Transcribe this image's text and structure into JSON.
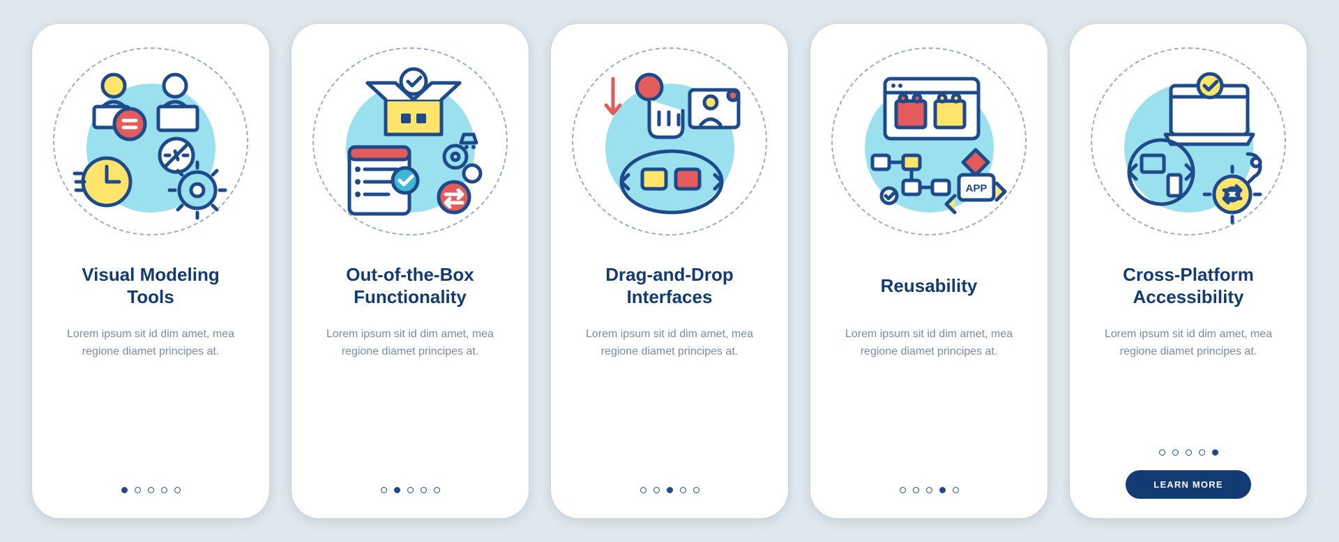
{
  "body_text": "Lorem ipsum sit id dim amet, mea regione diamet principes at.",
  "cta_label": "LEARN MORE",
  "total_steps": 5,
  "cards": [
    {
      "title": "Visual Modeling Tools",
      "icon": "visual-modeling-icon",
      "step_index": 0
    },
    {
      "title": "Out-of-the-Box Functionality",
      "icon": "out-of-box-icon",
      "step_index": 1
    },
    {
      "title": "Drag-and-Drop Interfaces",
      "icon": "drag-drop-icon",
      "step_index": 2
    },
    {
      "title": "Reusability",
      "icon": "reusability-icon",
      "step_index": 3
    },
    {
      "title": "Cross-Platform Accessibility",
      "icon": "cross-platform-icon",
      "step_index": 4
    }
  ]
}
